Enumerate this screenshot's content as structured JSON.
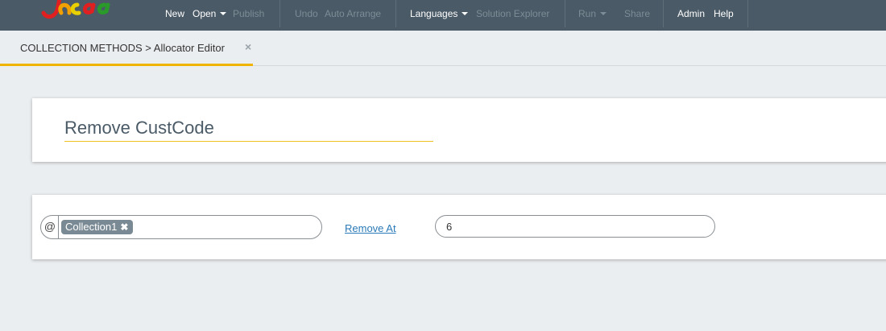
{
  "nav": {
    "new": "New",
    "open": "Open",
    "publish": "Publish",
    "undo": "Undo",
    "auto_arrange": "Auto Arrange",
    "languages": "Languages",
    "solution_explorer": "Solution Explorer",
    "run": "Run",
    "share": "Share",
    "admin": "Admin",
    "help": "Help"
  },
  "tab": {
    "label": "COLLECTION METHODS > Allocator Editor",
    "close": "×"
  },
  "editor": {
    "title": "Remove CustCode",
    "at_symbol": "@",
    "collection_chip": "Collection1",
    "chip_remove": "✖",
    "operation_link": "Remove At",
    "index_value": "6"
  },
  "colors": {
    "topbar": "#4a5a66",
    "accent": "#f0b400",
    "link": "#2a7ab8"
  }
}
